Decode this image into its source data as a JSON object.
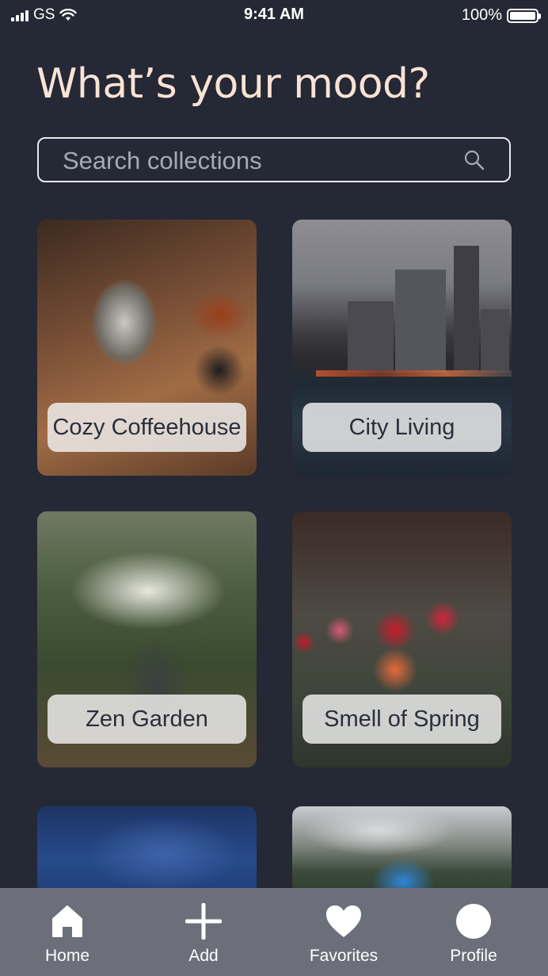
{
  "status_bar": {
    "carrier": "GS",
    "time": "9:41 AM",
    "battery": "100%"
  },
  "page": {
    "title": "What’s your mood?"
  },
  "search": {
    "placeholder": "Search collections",
    "icon": "search-icon"
  },
  "collections": [
    {
      "label": "Cozy Coffeehouse"
    },
    {
      "label": "City Living"
    },
    {
      "label": "Zen Garden"
    },
    {
      "label": "Smell of Spring"
    },
    {
      "label": ""
    },
    {
      "label": ""
    }
  ],
  "tabbar": {
    "items": [
      {
        "label": "Home",
        "icon": "home-icon"
      },
      {
        "label": "Add",
        "icon": "plus-icon"
      },
      {
        "label": "Favorites",
        "icon": "heart-icon"
      },
      {
        "label": "Profile",
        "icon": "profile-icon"
      }
    ]
  },
  "colors": {
    "background": "#252835",
    "title": "#f9e3d4",
    "tabbar": "#6c6f7a",
    "pill": "#f2f2f2"
  }
}
